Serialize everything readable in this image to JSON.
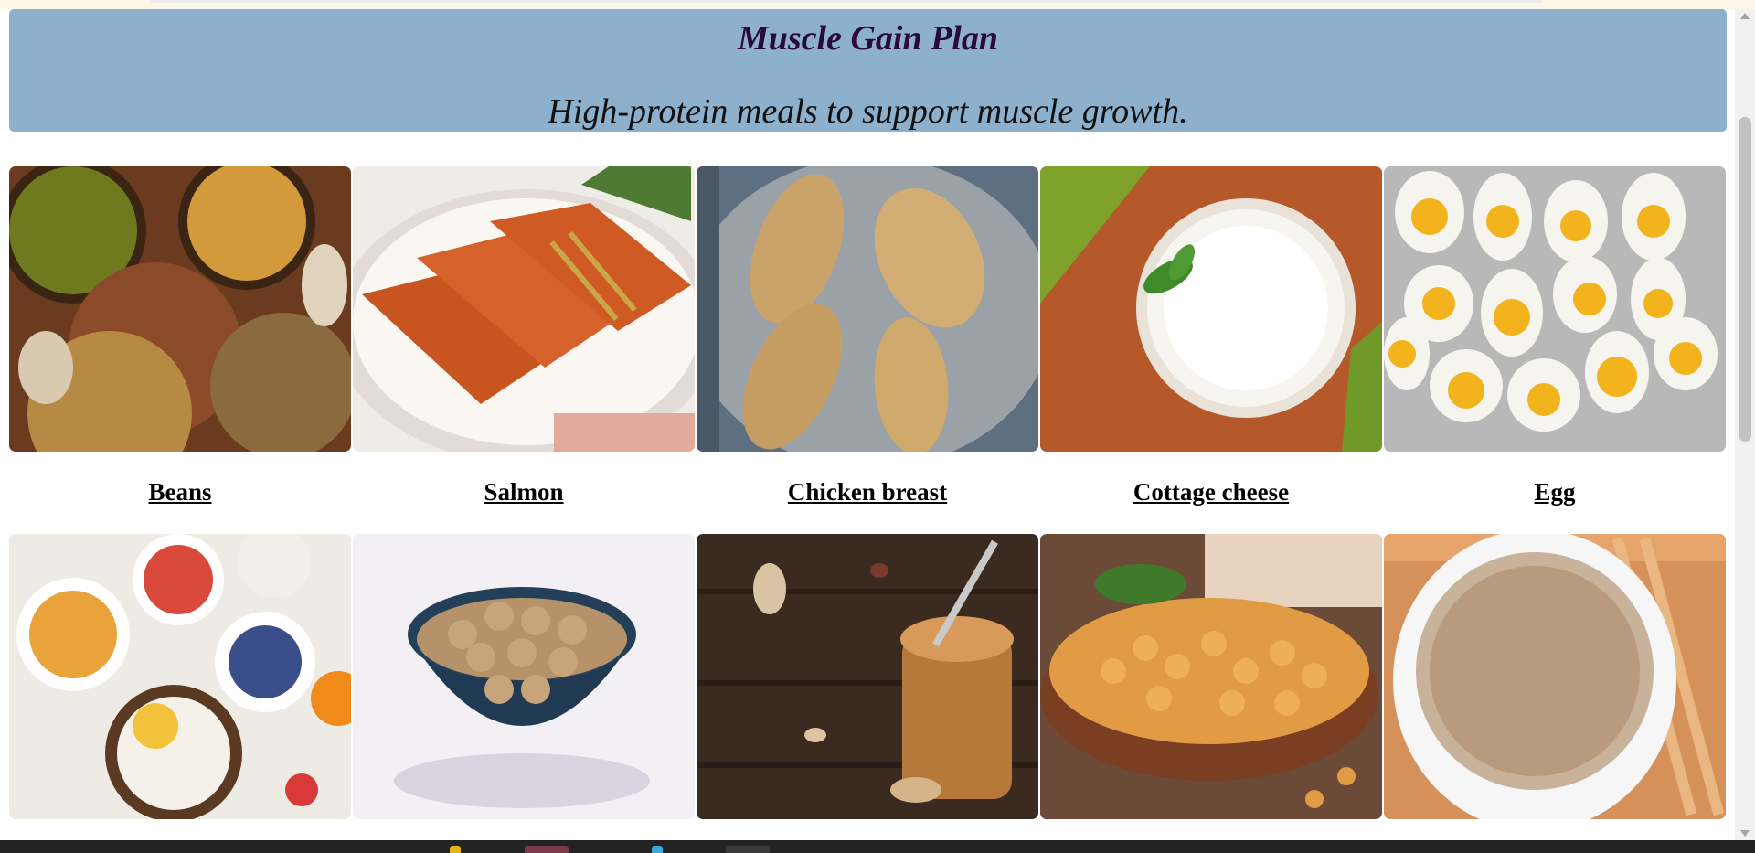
{
  "banner": {
    "title": "Muscle Gain Plan",
    "subtitle": "High-protein meals to support muscle growth."
  },
  "foods_row1": [
    {
      "label": "Beans",
      "icon": "beans-image"
    },
    {
      "label": "Salmon",
      "icon": "salmon-image"
    },
    {
      "label": "Chicken breast",
      "icon": "chicken-breast-image"
    },
    {
      "label": "Cottage cheese",
      "icon": "cottage-cheese-image"
    },
    {
      "label": "Egg",
      "icon": "egg-image"
    }
  ],
  "foods_row2": [
    {
      "icon": "yogurt-bowls-image"
    },
    {
      "icon": "soy-chunks-image"
    },
    {
      "icon": "peanut-butter-image"
    },
    {
      "icon": "chickpeas-image"
    },
    {
      "icon": "quinoa-image"
    }
  ],
  "colors": {
    "banner_bg": "#8db1cd",
    "title": "#2a0a3a",
    "caption": "#000000"
  }
}
